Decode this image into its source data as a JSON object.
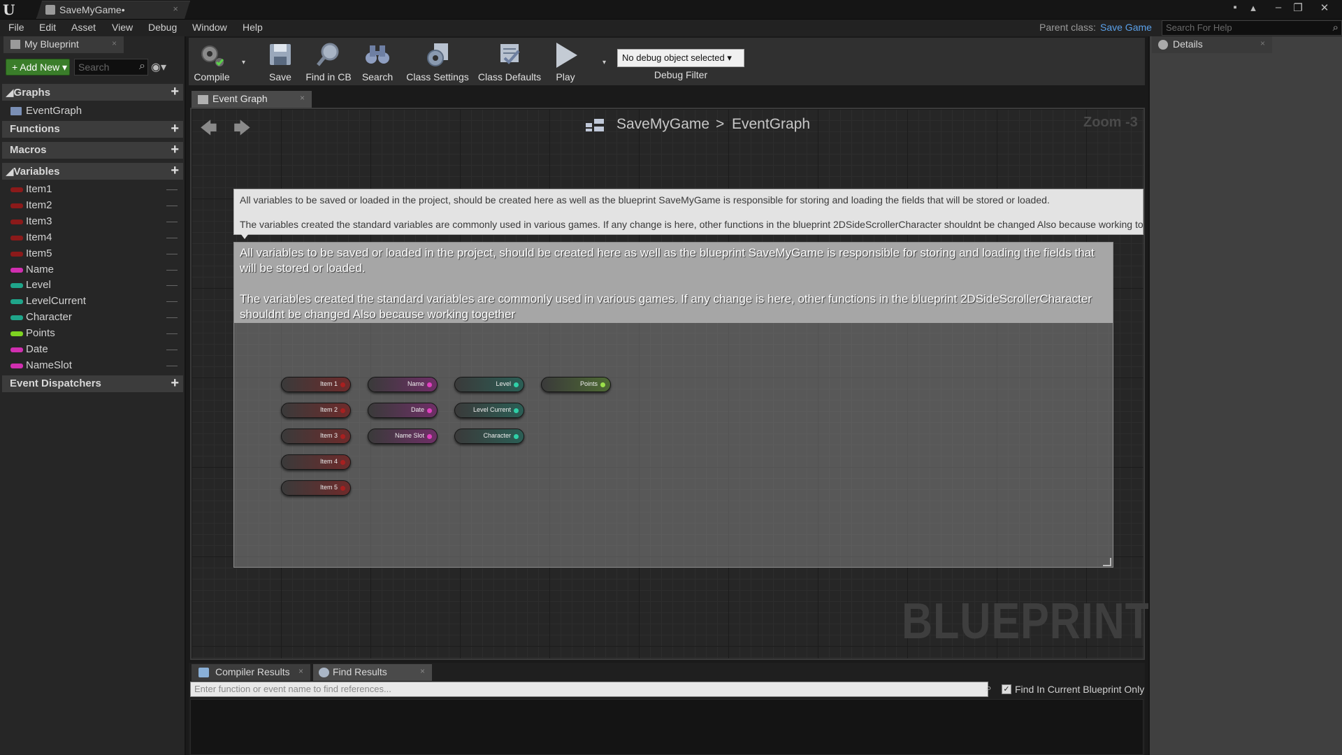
{
  "window": {
    "title": "SaveMyGame•",
    "close_glyph": "×",
    "controls": [
      "minimize-icon",
      "restore-icon",
      "close-icon"
    ]
  },
  "menu": {
    "items": [
      "File",
      "Edit",
      "Asset",
      "View",
      "Debug",
      "Window",
      "Help"
    ],
    "parent_class_label": "Parent class:",
    "parent_class_value": "Save Game",
    "help_search_placeholder": "Search For Help"
  },
  "my_blueprint": {
    "tab_label": "My Blueprint",
    "add_new_label": "Add New",
    "search_placeholder": "Search",
    "sections": {
      "graphs": "Graphs",
      "functions": "Functions",
      "macros": "Macros",
      "variables": "Variables",
      "event_dispatchers": "Event Dispatchers"
    },
    "graphs": [
      "EventGraph"
    ],
    "variables": [
      {
        "name": "Item1",
        "color": "#8b1a1a"
      },
      {
        "name": "Item2",
        "color": "#8b1a1a"
      },
      {
        "name": "Item3",
        "color": "#8b1a1a"
      },
      {
        "name": "Item4",
        "color": "#8b1a1a"
      },
      {
        "name": "Item5",
        "color": "#8b1a1a"
      },
      {
        "name": "Name",
        "color": "#d02fb0"
      },
      {
        "name": "Level",
        "color": "#1fa58a"
      },
      {
        "name": "LevelCurrent",
        "color": "#1fa58a"
      },
      {
        "name": "Character",
        "color": "#1fa58a"
      },
      {
        "name": "Points",
        "color": "#7ed321"
      },
      {
        "name": "Date",
        "color": "#d02fb0"
      },
      {
        "name": "NameSlot",
        "color": "#d02fb0"
      }
    ]
  },
  "toolbar": {
    "buttons": [
      {
        "label": "Compile",
        "icon": "compile-gear-icon"
      },
      {
        "label": "Save",
        "icon": "save-icon"
      },
      {
        "label": "Find in CB",
        "icon": "find-in-cb-icon"
      },
      {
        "label": "Search",
        "icon": "search-binoculars-icon"
      },
      {
        "label": "Class Settings",
        "icon": "class-settings-icon"
      },
      {
        "label": "Class Defaults",
        "icon": "class-defaults-icon"
      },
      {
        "label": "Play",
        "icon": "play-icon"
      }
    ],
    "debug_select_value": "No debug object selected",
    "debug_filter_label": "Debug Filter"
  },
  "graph": {
    "tab_label": "Event Graph",
    "breadcrumb": [
      "SaveMyGame",
      "EventGraph"
    ],
    "breadcrumb_separator": ">",
    "zoom_label": "Zoom -3",
    "watermark": "BLUEPRINT",
    "bubble_line1": "All variables to be saved or loaded in the project, should be created here as well as the blueprint SaveMyGame is responsible for storing and loading the fields that will be stored or loaded.",
    "bubble_line2": "The variables created the standard variables are commonly used in various games. If any change is here, other functions in the blueprint 2DSideScrollerCharacter shouldnt be changed Also because working together",
    "comment_text": "All variables to be saved or loaded in the project, should be created here as well as the blueprint SaveMyGame is responsible for storing and loading the fields that will be stored or loaded.\n\nThe variables created the standard variables are commonly used in various games. If any change is here, other functions in the blueprint 2DSideScrollerCharacter shouldnt be changed Also because working together",
    "nodes": [
      {
        "label": "Item 1",
        "col": 0,
        "row": 0,
        "color": "#6e2b2b",
        "pin": "#a82020"
      },
      {
        "label": "Item 2",
        "col": 0,
        "row": 1,
        "color": "#6e2b2b",
        "pin": "#a82020"
      },
      {
        "label": "Item 3",
        "col": 0,
        "row": 2,
        "color": "#6e2b2b",
        "pin": "#a82020"
      },
      {
        "label": "Item 4",
        "col": 0,
        "row": 3,
        "color": "#6e2b2b",
        "pin": "#a82020"
      },
      {
        "label": "Item 5",
        "col": 0,
        "row": 4,
        "color": "#6e2b2b",
        "pin": "#a82020"
      },
      {
        "label": "Name",
        "col": 1,
        "row": 0,
        "color": "#6e2f66",
        "pin": "#e040c0"
      },
      {
        "label": "Date",
        "col": 1,
        "row": 1,
        "color": "#6e2f66",
        "pin": "#e040c0"
      },
      {
        "label": "Name Slot",
        "col": 1,
        "row": 2,
        "color": "#6e2f66",
        "pin": "#e040c0"
      },
      {
        "label": "Level",
        "col": 2,
        "row": 0,
        "color": "#2b5e55",
        "pin": "#2fd0a8"
      },
      {
        "label": "Level Current",
        "col": 2,
        "row": 1,
        "color": "#2b5e55",
        "pin": "#2fd0a8"
      },
      {
        "label": "Character",
        "col": 2,
        "row": 2,
        "color": "#2b5e55",
        "pin": "#2fd0a8"
      },
      {
        "label": "Points",
        "col": 3,
        "row": 0,
        "color": "#4e6a33",
        "pin": "#9be04a"
      }
    ]
  },
  "bottom": {
    "tabs": [
      "Compiler Results",
      "Find Results"
    ],
    "find_placeholder": "Enter function or event name to find references...",
    "find_in_current_label": "Find In Current Blueprint Only",
    "find_in_current_checked": true
  },
  "details": {
    "tab_label": "Details"
  }
}
